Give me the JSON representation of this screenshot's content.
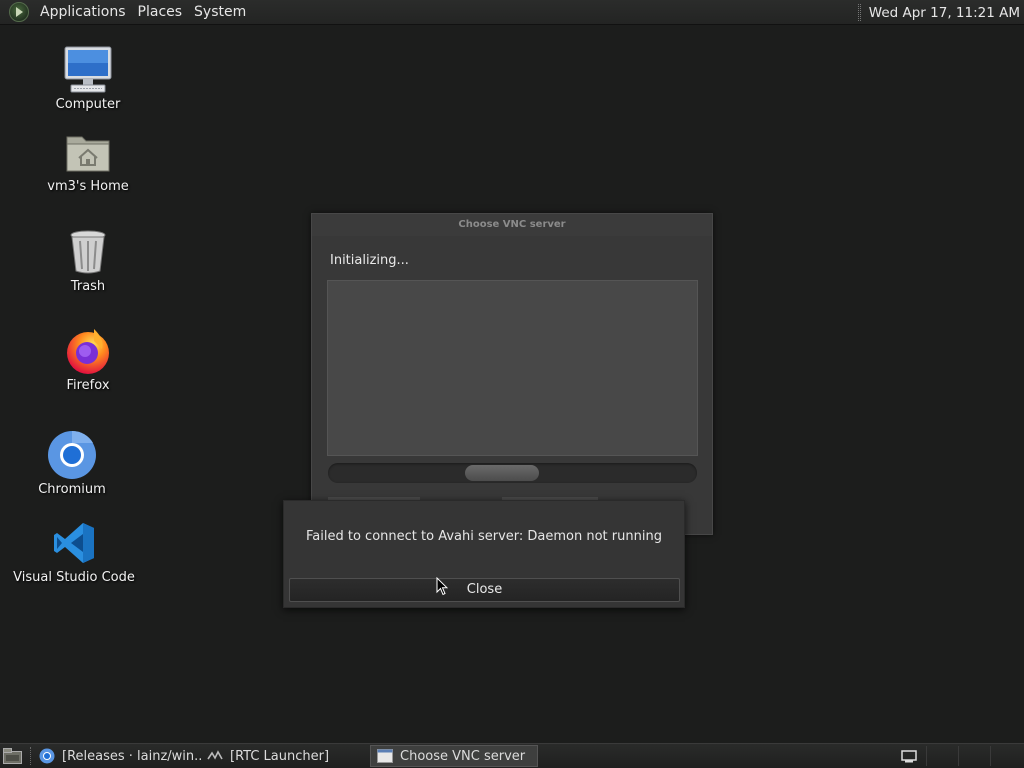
{
  "top_panel": {
    "menus": [
      "Applications",
      "Places",
      "System"
    ],
    "clock": "Wed Apr 17, 11:21 AM"
  },
  "desktop": {
    "icons": [
      {
        "label": "Computer",
        "icon": "computer-icon"
      },
      {
        "label": "vm3's Home",
        "icon": "home-folder-icon"
      },
      {
        "label": "Trash",
        "icon": "trash-icon"
      },
      {
        "label": "Firefox",
        "icon": "firefox-icon"
      },
      {
        "label": "Chromium",
        "icon": "chromium-icon"
      },
      {
        "label": "Visual Studio Code",
        "icon": "vscode-icon"
      }
    ]
  },
  "vnc_window": {
    "title": "Choose VNC server",
    "status": "Initializing...",
    "progress_indeterminate": true
  },
  "error_dialog": {
    "message": "Failed to connect to Avahi server: Daemon not running",
    "button_label": "Close"
  },
  "taskbar": {
    "tasks": [
      {
        "label": "[Releases · lainz/win...",
        "icon": "chromium-icon",
        "active": false
      },
      {
        "label": "[RTC Launcher]",
        "icon": "rtc-launcher-icon",
        "active": false
      },
      {
        "label": "Choose VNC server",
        "icon": "window-icon",
        "active": true
      }
    ]
  },
  "colors": {
    "desktop_bg": "#1c1d1c",
    "panel_bg": "#262726",
    "dialog_bg": "#383838",
    "active_task": "#3e3f3e"
  }
}
